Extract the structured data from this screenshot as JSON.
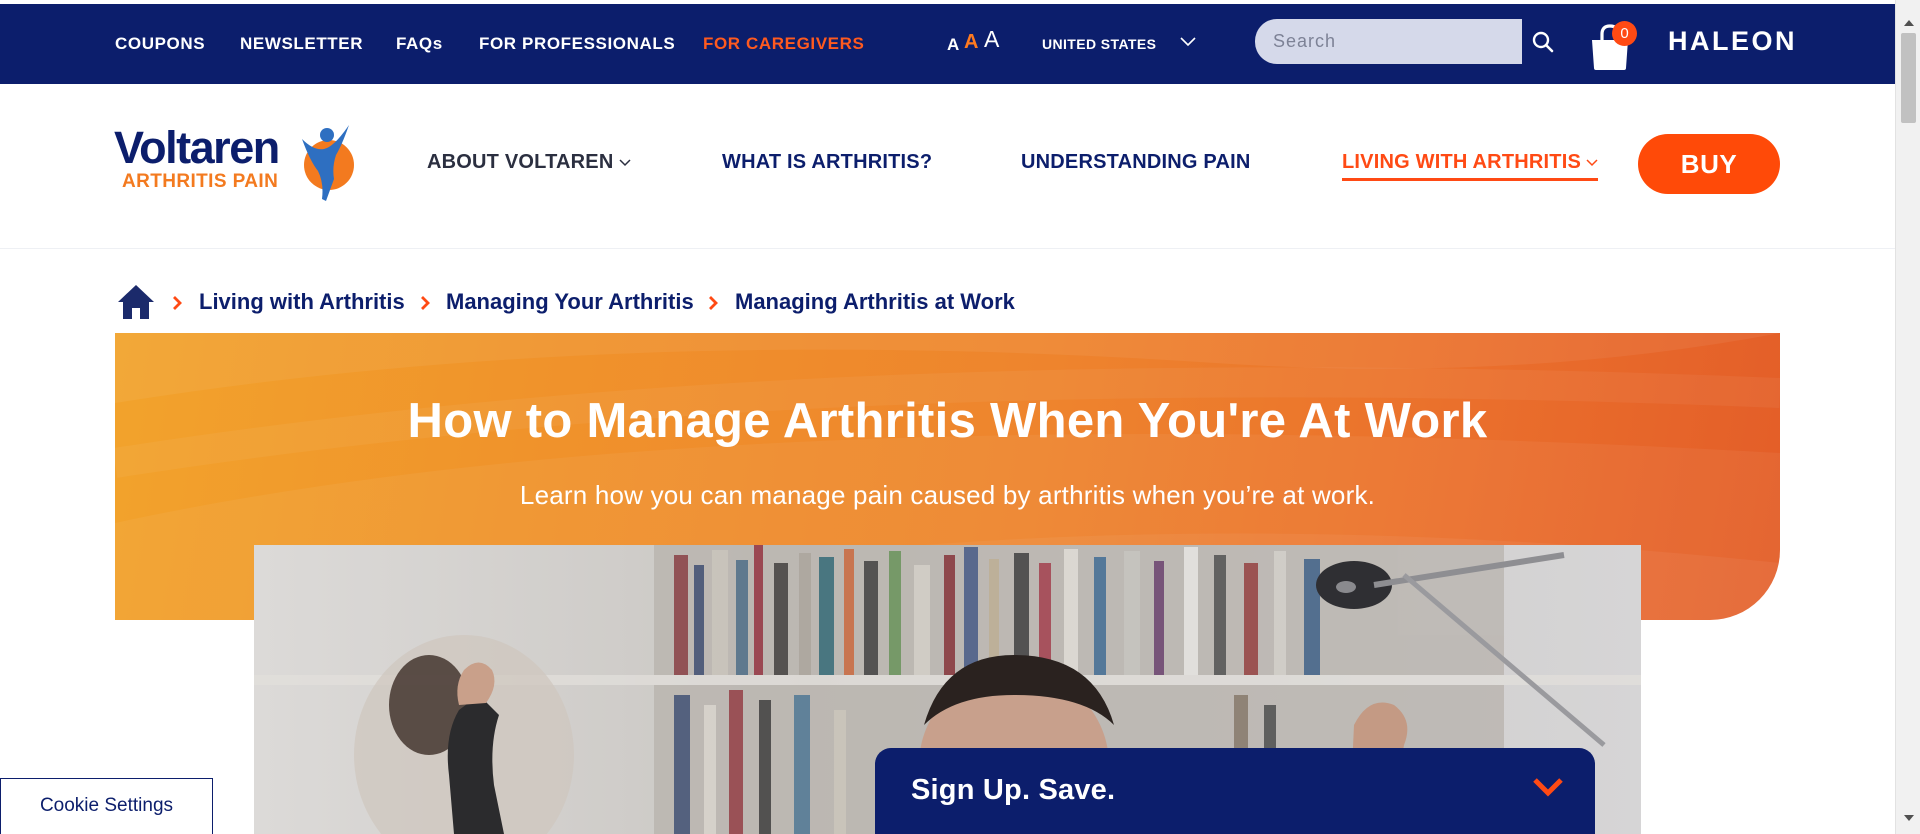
{
  "topbar": {
    "links": [
      "COUPONS",
      "NEWSLETTER",
      "FAQs",
      "FOR PROFESSIONALS",
      "FOR CAREGIVERS"
    ],
    "font_sizes": [
      "A",
      "A",
      "A"
    ],
    "country": "UNITED STATES",
    "search_placeholder": "Search",
    "cart_count": "0",
    "brand": "HALEON"
  },
  "logo": {
    "name": "Voltaren",
    "subtitle": "ARTHRITIS PAIN"
  },
  "nav": {
    "items": [
      "ABOUT VOLTAREN",
      "WHAT IS ARTHRITIS?",
      "UNDERSTANDING PAIN",
      "LIVING WITH ARTHRITIS"
    ],
    "buy_label": "BUY"
  },
  "breadcrumb": {
    "items": [
      "Living with Arthritis",
      "Managing Your Arthritis",
      "Managing Arthritis at Work"
    ]
  },
  "hero": {
    "title": "How to Manage Arthritis When You're At Work",
    "subtitle": "Learn how you can manage pain caused by arthritis when you’re at work."
  },
  "signup": {
    "title": "Sign Up. Save."
  },
  "cookie": {
    "label": "Cookie Settings"
  },
  "colors": {
    "navy": "#0c1e6c",
    "orange": "#ff4a14",
    "hero_start": "#f2a32c",
    "hero_end": "#e35d28"
  },
  "icons": {
    "search": "search-icon",
    "cart": "shopping-bag-icon",
    "home": "home-icon",
    "chevron": "chevron-down-icon"
  }
}
